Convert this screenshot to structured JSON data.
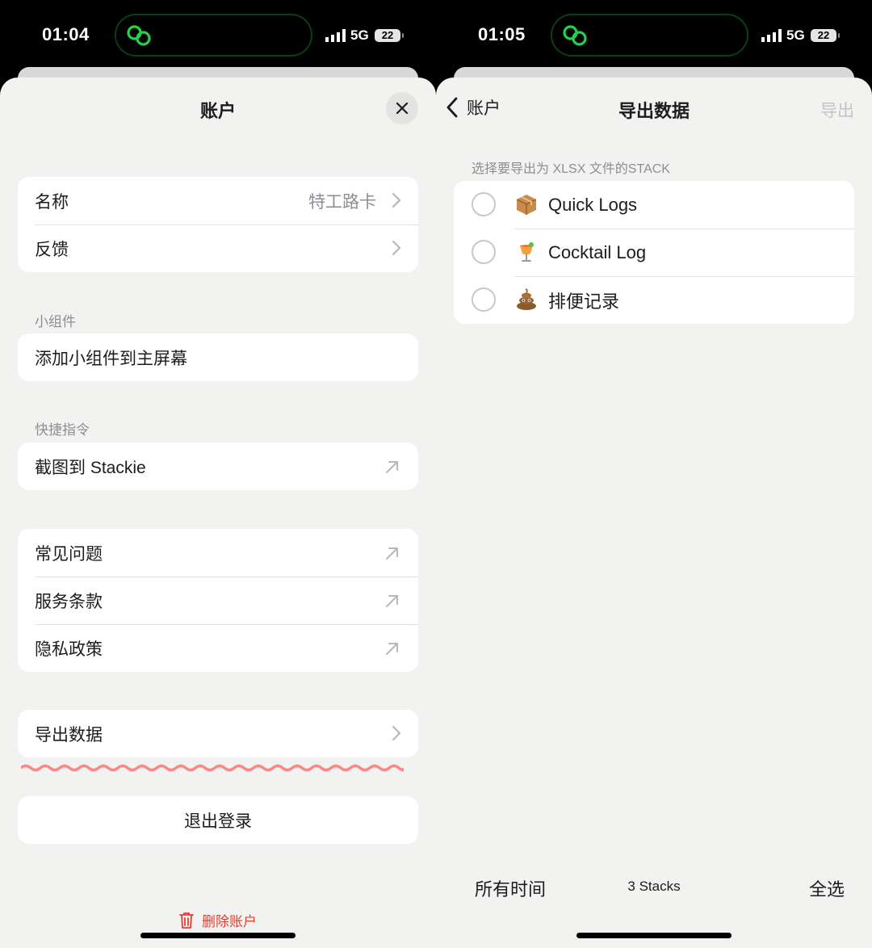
{
  "left": {
    "status": {
      "time": "01:04",
      "network": "5G",
      "battery": "22"
    },
    "title": "账户",
    "group1": [
      {
        "label": "名称",
        "value": "特工路卡"
      },
      {
        "label": "反馈"
      }
    ],
    "widgets": {
      "section": "小组件",
      "item": "添加小组件到主屏幕"
    },
    "shortcuts": {
      "section": "快捷指令",
      "item": "截图到 Stackie"
    },
    "links": [
      "常见问题",
      "服务条款",
      "隐私政策"
    ],
    "export_item": "导出数据",
    "logout": "退出登录",
    "delete": "删除账户"
  },
  "right": {
    "status": {
      "time": "01:05",
      "network": "5G",
      "battery": "22"
    },
    "back_label": "账户",
    "title": "导出数据",
    "export_btn": "导出",
    "hint": "选择要导出为 XLSX 文件的STACK",
    "stacks": [
      {
        "icon": "package-icon",
        "name": "Quick Logs",
        "selected": false
      },
      {
        "icon": "cocktail-icon",
        "name": "Cocktail Log",
        "selected": false
      },
      {
        "icon": "poop-icon",
        "name": "排便记录",
        "selected": false
      }
    ],
    "bottom": {
      "range": "所有时间",
      "count": "3 Stacks",
      "select_all": "全选"
    }
  },
  "colors": {
    "accent_green": "#27d04a",
    "destructive": "#e43d30",
    "annotation_red": "#ff6b6b"
  }
}
